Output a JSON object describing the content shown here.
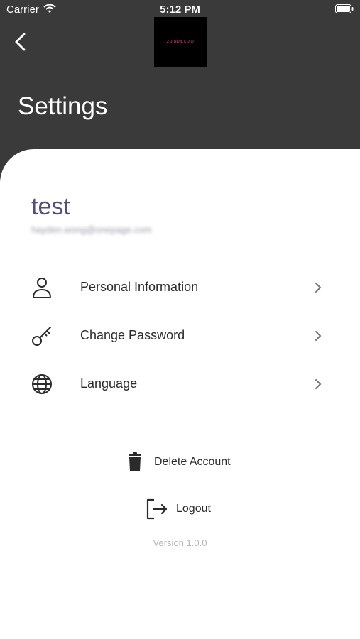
{
  "status_bar": {
    "carrier": "Carrier",
    "time": "5:12 PM",
    "wifi_icon": "wifi-icon",
    "battery_icon": "battery-icon"
  },
  "header": {
    "back_icon": "chevron-left-icon",
    "logo_text": "zumba.com",
    "title": "Settings",
    "background_color": "#3a3a3a"
  },
  "profile": {
    "username": "test",
    "email": "hayden.wong@onepage.com"
  },
  "menu": {
    "items": [
      {
        "label": "Personal Information",
        "icon": "user-icon"
      },
      {
        "label": "Change Password",
        "icon": "key-icon"
      },
      {
        "label": "Language",
        "icon": "globe-icon"
      }
    ]
  },
  "actions": {
    "delete_account": "Delete Account",
    "delete_icon": "trash-icon",
    "logout": "Logout",
    "logout_icon": "logout-icon"
  },
  "version": "Version 1.0.0",
  "colors": {
    "username": "#52507a",
    "text": "#2b2b2b",
    "muted": "#b5b5b5"
  }
}
